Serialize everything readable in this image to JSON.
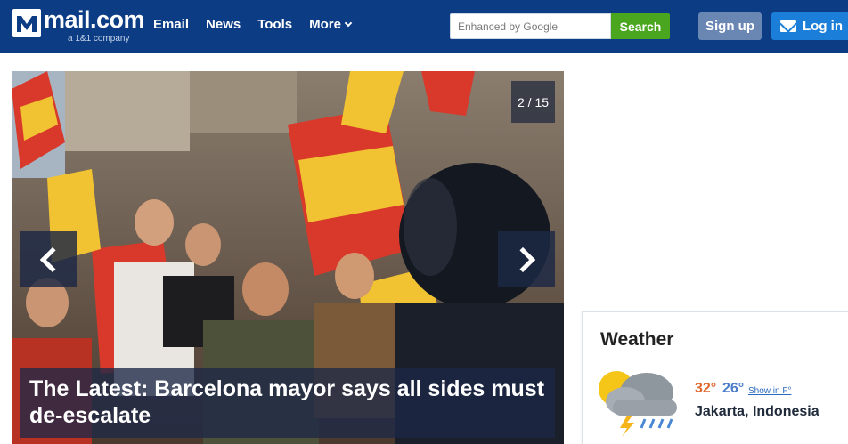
{
  "header": {
    "logo_text": "mail.com",
    "logo_subtext": "a 1&1 company",
    "nav": [
      {
        "label": "Email"
      },
      {
        "label": "News"
      },
      {
        "label": "Tools"
      },
      {
        "label": "More"
      }
    ],
    "search": {
      "placeholder": "Enhanced by Google",
      "button_label": "Search"
    },
    "signup_label": "Sign up",
    "login_label": "Log in"
  },
  "slideshow": {
    "counter": "2 / 15",
    "caption": "The Latest: Barcelona mayor says all sides must de-escalate"
  },
  "weather": {
    "title": "Weather",
    "temp_high": "32°",
    "temp_low": "26°",
    "unit_link": "Show in F°",
    "location": "Jakarta, Indonesia",
    "condition_icon": "thunderstorm-partly-sunny-icon"
  },
  "colors": {
    "header_bg": "#0b3c84",
    "search_button": "#4aa51f",
    "signup_button": "#6a87b3",
    "login_button": "#1b7fd9",
    "temp_high": "#e0662c",
    "temp_low": "#4a7cc7"
  }
}
